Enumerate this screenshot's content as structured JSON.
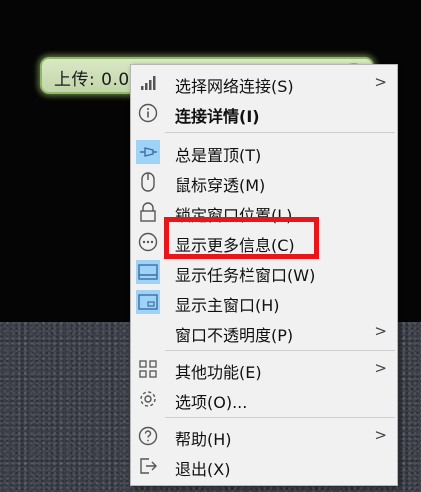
{
  "widget": {
    "text": "上传: 0.0"
  },
  "menu": {
    "items": [
      {
        "label": "选择网络连接(S)",
        "icon": "signal-bars-icon",
        "submenu": true
      },
      {
        "label": "连接详情(I)",
        "icon": "info-circle-icon",
        "bold": true
      },
      {
        "label": "总是置顶(T)",
        "icon": "pin-icon",
        "checked": true
      },
      {
        "label": "鼠标穿透(M)",
        "icon": "mouse-icon"
      },
      {
        "label": "锁定窗口位置(L)",
        "icon": "lock-icon"
      },
      {
        "label": "显示更多信息(C)",
        "icon": "more-dots-icon"
      },
      {
        "label": "显示任务栏窗口(W)",
        "icon": "taskbar-window-icon",
        "checked": true
      },
      {
        "label": "显示主窗口(H)",
        "icon": "main-window-icon",
        "checked": true
      },
      {
        "label": "窗口不透明度(P)",
        "submenu": true
      },
      {
        "label": "其他功能(E)",
        "icon": "grid-icon",
        "submenu": true
      },
      {
        "label": "选项(O)...",
        "icon": "gear-icon"
      },
      {
        "label": "帮助(H)",
        "icon": "help-circle-icon",
        "submenu": true
      },
      {
        "label": "退出(X)",
        "icon": "exit-icon"
      }
    ],
    "submenu_arrow": ">"
  },
  "colors": {
    "highlight_box": "#e8151b",
    "checked_bg": "#9ed3f7",
    "widget_border": "#8fb866"
  }
}
